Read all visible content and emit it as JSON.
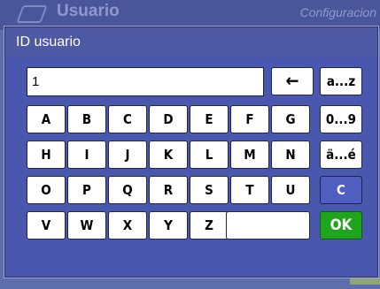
{
  "background": {
    "app_title": "Usuario",
    "config_label": "Configuracion"
  },
  "dialog": {
    "title": "ID usuario",
    "input_value": "1"
  },
  "keys": {
    "row1": [
      "A",
      "B",
      "C",
      "D",
      "E",
      "F",
      "G"
    ],
    "row2": [
      "H",
      "I",
      "J",
      "K",
      "L",
      "M",
      "N"
    ],
    "row3": [
      "O",
      "P",
      "Q",
      "R",
      "S",
      "T",
      "U"
    ],
    "row4": [
      "V",
      "W",
      "X",
      "Y",
      "Z"
    ],
    "backspace": "←",
    "lowercase": "a...z",
    "digits": "0...9",
    "special": "ä...é",
    "clear": "C",
    "ok": "OK"
  },
  "colors": {
    "panel": "#4a57ae",
    "title_bar": "#4e58a3",
    "clear_key": "#4f5fc0",
    "ok_key": "#1fa51c"
  }
}
